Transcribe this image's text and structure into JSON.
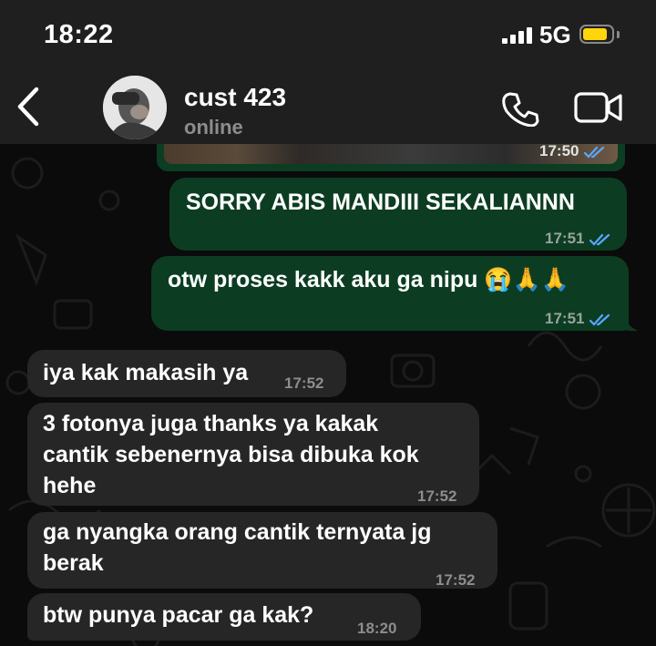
{
  "status_bar": {
    "time": "18:22",
    "network": "5G",
    "battery_level": 0.85,
    "battery_color": "#ffd60a"
  },
  "header": {
    "contact_name": "cust 423",
    "contact_status": "online"
  },
  "messages": [
    {
      "direction": "out",
      "kind": "photo",
      "text": "",
      "time": "17:50",
      "read": true
    },
    {
      "direction": "out",
      "text": "SORRY ABIS MANDIII SEKALIANNN",
      "time": "17:51",
      "read": true
    },
    {
      "direction": "out",
      "text": "otw proses kakk aku ga nipu 😭🙏🙏",
      "time": "17:51",
      "read": true
    },
    {
      "direction": "in",
      "text": "iya kak makasih ya",
      "time": "17:52"
    },
    {
      "direction": "in",
      "lines": [
        "3 fotonya juga thanks ya kakak",
        "cantik sebenernya bisa dibuka kok",
        "hehe"
      ],
      "time": "17:52"
    },
    {
      "direction": "in",
      "lines": [
        "ga nyangka orang cantik ternyata jg",
        "berak"
      ],
      "time": "17:52"
    },
    {
      "direction": "in",
      "text": "btw punya pacar ga kak?",
      "time": "18:20"
    }
  ],
  "colors": {
    "outgoing_bubble": "#0c3d22",
    "incoming_bubble": "#262626",
    "read_ticks": "#5aa6ff",
    "bar_background": "#1f1f1f"
  }
}
